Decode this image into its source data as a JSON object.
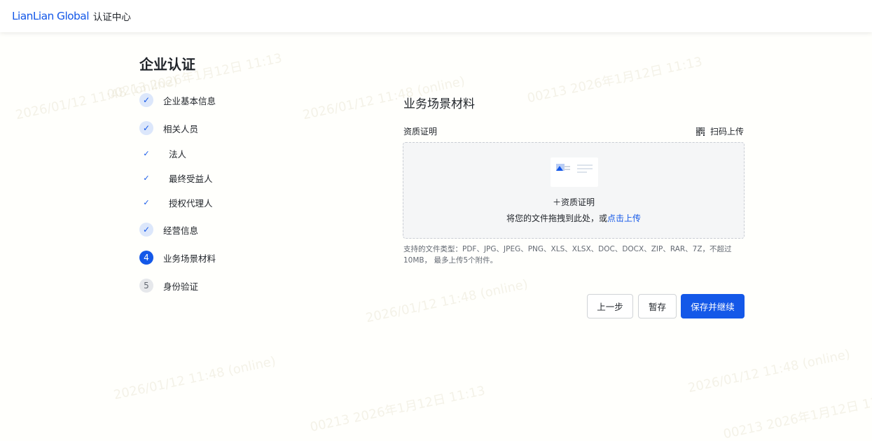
{
  "header": {
    "logo_text": "LianLian Global",
    "title": "认证中心"
  },
  "page": {
    "title": "企业认证"
  },
  "steps": [
    {
      "label": "企业基本信息",
      "state": "done",
      "marker": "✓"
    },
    {
      "label": "相关人员",
      "state": "done",
      "marker": "✓"
    },
    {
      "label": "经营信息",
      "state": "done",
      "marker": "✓"
    },
    {
      "label": "业务场景材料",
      "state": "active",
      "marker": "4"
    },
    {
      "label": "身份验证",
      "state": "pending",
      "marker": "5"
    }
  ],
  "substeps": [
    {
      "label": "法人",
      "marker": "✓"
    },
    {
      "label": "最终受益人",
      "marker": "✓"
    },
    {
      "label": "授权代理人",
      "marker": "✓"
    }
  ],
  "main": {
    "section_title": "业务场景材料",
    "field_label": "资质证明",
    "scan_upload": "扫码上传",
    "dropzone": {
      "add_label": "＋资质证明",
      "hint_prefix": "将您的文件拖拽到此处，或",
      "hint_link": "点击上传"
    },
    "file_types_note": "支持的文件类型：PDF、JPG、JPEG、PNG、XLS、XLSX、DOC、DOCX、ZIP、RAR、7Z，不超过10MB， 最多上传5个附件。"
  },
  "buttons": {
    "prev": "上一步",
    "save_draft": "暂存",
    "save_continue": "保存并继续"
  },
  "watermark": {
    "texts": [
      "00213 2026年1月12日 11:13",
      "2026/01/12 11:48 (online)"
    ]
  },
  "colors": {
    "primary": "#1458e8",
    "step_done_bg": "#dce7fb",
    "step_pending_bg": "#e6e8eb",
    "dropzone_bg": "#f5f6f7"
  },
  "icons": {
    "check": "check-icon",
    "qr": "qr-code-icon",
    "file": "file-image-icon"
  }
}
